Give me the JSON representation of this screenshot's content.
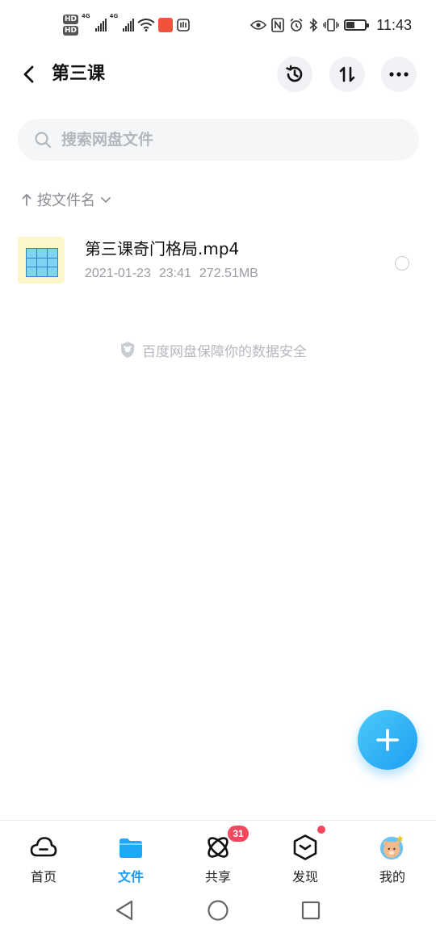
{
  "status_bar": {
    "hd_labels": [
      "HD",
      "HD"
    ],
    "network_labels": [
      "4G",
      "4G"
    ],
    "time": "11:43",
    "battery_level": 0.5
  },
  "header": {
    "title": "第三课",
    "back_icon": "chevron-left-icon",
    "actions": [
      "history-icon",
      "sort-toggle-icon",
      "more-icon"
    ]
  },
  "search": {
    "placeholder": "搜索网盘文件",
    "value": ""
  },
  "sort": {
    "label": "按文件名",
    "direction": "ascending"
  },
  "files": [
    {
      "name": "第三课奇门格局.mp4",
      "date": "2021-01-23",
      "time": "23:41",
      "size": "272.51MB",
      "selected": false
    }
  ],
  "safety_note": "百度网盘保障你的数据安全",
  "fab": {
    "icon": "plus-icon"
  },
  "tabs": [
    {
      "label": "首页",
      "icon": "cloud-icon",
      "active": false
    },
    {
      "label": "文件",
      "icon": "folder-icon",
      "active": true
    },
    {
      "label": "共享",
      "icon": "atom-icon",
      "active": false,
      "badge": "31"
    },
    {
      "label": "发现",
      "icon": "cube-icon",
      "active": false,
      "dot": true
    },
    {
      "label": "我的",
      "icon": "avatar-icon",
      "active": false
    }
  ],
  "colors": {
    "accent": "#1a9bf0",
    "badge": "#f2485f",
    "muted_text": "#9a9da3",
    "search_bg": "#f5f6f8"
  }
}
